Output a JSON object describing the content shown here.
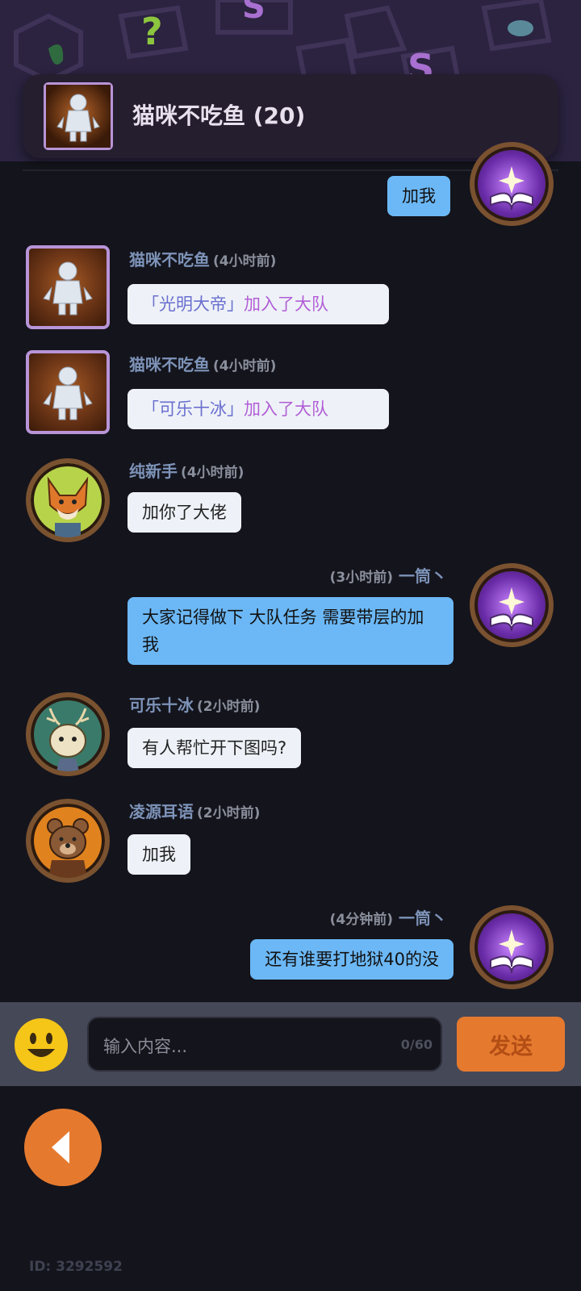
{
  "group": {
    "title": "猫咪不吃鱼 (20)"
  },
  "messages": [
    {
      "side": "me",
      "text": "加我"
    },
    {
      "side": "other",
      "name": "猫咪不吃鱼",
      "time": "(4小时前)",
      "system": true,
      "quoted_name": "「光明大帝」",
      "action": "加入了大队"
    },
    {
      "side": "other",
      "name": "猫咪不吃鱼",
      "time": "(4小时前)",
      "system": true,
      "quoted_name": "「可乐十冰」",
      "action": "加入了大队"
    },
    {
      "side": "other",
      "name": "纯新手",
      "time": "(4小时前)",
      "text": "加你了大佬"
    },
    {
      "side": "me",
      "name": "一筒丶",
      "time": "(3小时前)",
      "text": "大家记得做下 大队任务  需要带层的加我"
    },
    {
      "side": "other",
      "name": "可乐十冰",
      "time": "(2小时前)",
      "text": "有人帮忙开下图吗?"
    },
    {
      "side": "other",
      "name": "凌源耳语",
      "time": "(2小时前)",
      "text": "加我"
    },
    {
      "side": "me",
      "name": "一筒丶",
      "time": "(4分钟前)",
      "text": "还有谁要打地狱40的没"
    }
  ],
  "input": {
    "placeholder": "输入内容...",
    "counter": "0/60"
  },
  "send_label": "发送",
  "user_id": "ID: 3292592",
  "colors": {
    "accent": "#e57a2f",
    "my_bubble": "#6cb8f6",
    "other_bubble": "#eef2f8",
    "name_text": "#7d93b8"
  }
}
